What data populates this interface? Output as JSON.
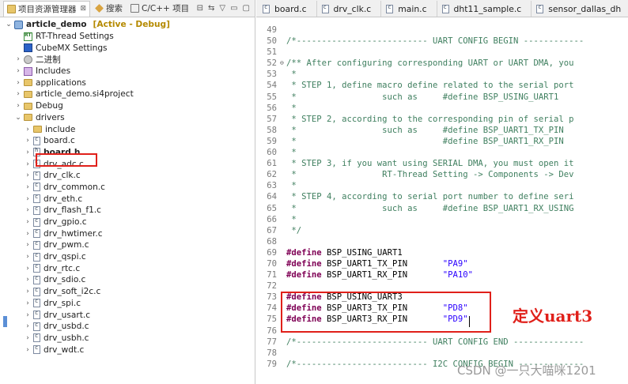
{
  "left_panel": {
    "tabs": [
      {
        "label": "项目资源管理器",
        "active": true,
        "close": "⊠"
      },
      {
        "label": "搜索",
        "active": false
      },
      {
        "label": "C/C++ 项目",
        "active": false
      }
    ],
    "tools": [
      "⊟",
      "⇆",
      "▽",
      "▭",
      "▢"
    ],
    "tree": [
      {
        "depth": 0,
        "twisty": "⌄",
        "icon": "proj",
        "label": "article_demo",
        "status": "[Active - Debug]"
      },
      {
        "depth": 1,
        "twisty": "",
        "icon": "rt",
        "label": "RT-Thread Settings"
      },
      {
        "depth": 1,
        "twisty": "",
        "icon": "mx",
        "label": "CubeMX Settings"
      },
      {
        "depth": 1,
        "twisty": "›",
        "icon": "bin",
        "label": "二进制"
      },
      {
        "depth": 1,
        "twisty": "›",
        "icon": "inc",
        "label": "Includes"
      },
      {
        "depth": 1,
        "twisty": "›",
        "icon": "folder",
        "label": "applications"
      },
      {
        "depth": 1,
        "twisty": "›",
        "icon": "folder",
        "label": "article_demo.si4project"
      },
      {
        "depth": 1,
        "twisty": "›",
        "icon": "folder",
        "label": "Debug"
      },
      {
        "depth": 1,
        "twisty": "⌄",
        "icon": "folder",
        "label": "drivers"
      },
      {
        "depth": 2,
        "twisty": "›",
        "icon": "folder",
        "label": "include"
      },
      {
        "depth": 2,
        "twisty": "›",
        "icon": "file",
        "label": "board.c"
      },
      {
        "depth": 2,
        "twisty": "›",
        "icon": "fileh",
        "label": "board.h",
        "bold": true
      },
      {
        "depth": 2,
        "twisty": "›",
        "icon": "file",
        "label": "drv_adc.c"
      },
      {
        "depth": 2,
        "twisty": "›",
        "icon": "file",
        "label": "drv_clk.c"
      },
      {
        "depth": 2,
        "twisty": "›",
        "icon": "file",
        "label": "drv_common.c"
      },
      {
        "depth": 2,
        "twisty": "›",
        "icon": "file",
        "label": "drv_eth.c"
      },
      {
        "depth": 2,
        "twisty": "›",
        "icon": "file",
        "label": "drv_flash_f1.c"
      },
      {
        "depth": 2,
        "twisty": "›",
        "icon": "file",
        "label": "drv_gpio.c"
      },
      {
        "depth": 2,
        "twisty": "›",
        "icon": "file",
        "label": "drv_hwtimer.c"
      },
      {
        "depth": 2,
        "twisty": "›",
        "icon": "file",
        "label": "drv_pwm.c"
      },
      {
        "depth": 2,
        "twisty": "›",
        "icon": "file",
        "label": "drv_qspi.c"
      },
      {
        "depth": 2,
        "twisty": "›",
        "icon": "file",
        "label": "drv_rtc.c"
      },
      {
        "depth": 2,
        "twisty": "›",
        "icon": "file",
        "label": "drv_sdio.c"
      },
      {
        "depth": 2,
        "twisty": "›",
        "icon": "file",
        "label": "drv_soft_i2c.c"
      },
      {
        "depth": 2,
        "twisty": "›",
        "icon": "file",
        "label": "drv_spi.c"
      },
      {
        "depth": 2,
        "twisty": "›",
        "icon": "file",
        "label": "drv_usart.c"
      },
      {
        "depth": 2,
        "twisty": "›",
        "icon": "file",
        "label": "drv_usbd.c"
      },
      {
        "depth": 2,
        "twisty": "›",
        "icon": "file",
        "label": "drv_usbh.c"
      },
      {
        "depth": 2,
        "twisty": "›",
        "icon": "file",
        "label": "drv_wdt.c"
      }
    ]
  },
  "editor": {
    "tabs": [
      "board.c",
      "drv_clk.c",
      "main.c",
      "dht11_sample.c",
      "sensor_dallas_dh"
    ],
    "lines": [
      {
        "n": "49",
        "parts": [
          {
            "t": "",
            "c": "plain"
          }
        ]
      },
      {
        "n": "50",
        "parts": [
          {
            "t": "/*-------------------------- UART CONFIG BEGIN ------------",
            "c": "cmt"
          }
        ]
      },
      {
        "n": "51",
        "parts": [
          {
            "t": "",
            "c": "plain"
          }
        ]
      },
      {
        "n": "52",
        "fold": "⊖",
        "parts": [
          {
            "t": "/** After configuring corresponding UART or UART DMA, you",
            "c": "cmt"
          }
        ]
      },
      {
        "n": "53",
        "parts": [
          {
            "t": " *",
            "c": "cmt"
          }
        ]
      },
      {
        "n": "54",
        "parts": [
          {
            "t": " * STEP 1, define macro define related to the serial port",
            "c": "cmt"
          }
        ]
      },
      {
        "n": "55",
        "parts": [
          {
            "t": " *                 such as     #define BSP_USING_UART1",
            "c": "cmt"
          }
        ]
      },
      {
        "n": "56",
        "parts": [
          {
            "t": " *",
            "c": "cmt"
          }
        ]
      },
      {
        "n": "57",
        "parts": [
          {
            "t": " * STEP 2, according to the corresponding pin of serial p",
            "c": "cmt"
          }
        ]
      },
      {
        "n": "58",
        "parts": [
          {
            "t": " *                 such as     #define BSP_UART1_TX_PIN",
            "c": "cmt"
          }
        ]
      },
      {
        "n": "59",
        "parts": [
          {
            "t": " *                             #define BSP_UART1_RX_PIN",
            "c": "cmt"
          }
        ]
      },
      {
        "n": "60",
        "parts": [
          {
            "t": " *",
            "c": "cmt"
          }
        ]
      },
      {
        "n": "61",
        "parts": [
          {
            "t": " * STEP 3, if you want using SERIAL DMA, you must open it",
            "c": "cmt"
          }
        ]
      },
      {
        "n": "62",
        "parts": [
          {
            "t": " *                 RT-Thread Setting -> Components -> Dev",
            "c": "cmt"
          }
        ]
      },
      {
        "n": "63",
        "parts": [
          {
            "t": " *",
            "c": "cmt"
          }
        ]
      },
      {
        "n": "64",
        "parts": [
          {
            "t": " * STEP 4, according to serial port number to define seri",
            "c": "cmt"
          }
        ]
      },
      {
        "n": "65",
        "parts": [
          {
            "t": " *                 such as     #define BSP_UART1_RX_USING",
            "c": "cmt"
          }
        ]
      },
      {
        "n": "66",
        "parts": [
          {
            "t": " *",
            "c": "cmt"
          }
        ]
      },
      {
        "n": "67",
        "parts": [
          {
            "t": " */",
            "c": "cmt"
          }
        ]
      },
      {
        "n": "68",
        "parts": [
          {
            "t": "",
            "c": "plain"
          }
        ]
      },
      {
        "n": "69",
        "parts": [
          {
            "t": "#define",
            "c": "kw"
          },
          {
            "t": " BSP_USING_UART1",
            "c": "plain"
          }
        ]
      },
      {
        "n": "70",
        "parts": [
          {
            "t": "#define",
            "c": "kw"
          },
          {
            "t": " BSP_UART1_TX_PIN       ",
            "c": "plain"
          },
          {
            "t": "\"PA9\"",
            "c": "str"
          }
        ]
      },
      {
        "n": "71",
        "parts": [
          {
            "t": "#define",
            "c": "kw"
          },
          {
            "t": " BSP_UART1_RX_PIN       ",
            "c": "plain"
          },
          {
            "t": "\"PA10\"",
            "c": "str"
          }
        ]
      },
      {
        "n": "72",
        "parts": [
          {
            "t": "",
            "c": "plain"
          }
        ]
      },
      {
        "n": "73",
        "parts": [
          {
            "t": "#define",
            "c": "kw"
          },
          {
            "t": " BSP_USING_UART3",
            "c": "plain"
          }
        ]
      },
      {
        "n": "74",
        "parts": [
          {
            "t": "#define",
            "c": "kw"
          },
          {
            "t": " BSP_UART3_TX_PIN       ",
            "c": "plain"
          },
          {
            "t": "\"PD8\"",
            "c": "str"
          }
        ]
      },
      {
        "n": "75",
        "parts": [
          {
            "t": "#define",
            "c": "kw"
          },
          {
            "t": " BSP_UART3_RX_PIN       ",
            "c": "plain"
          },
          {
            "t": "\"PD9\"",
            "c": "str"
          }
        ]
      },
      {
        "n": "76",
        "parts": [
          {
            "t": "",
            "c": "plain"
          }
        ]
      },
      {
        "n": "77",
        "parts": [
          {
            "t": "/*-------------------------- UART CONFIG END --------------",
            "c": "cmt"
          }
        ]
      },
      {
        "n": "78",
        "parts": [
          {
            "t": "",
            "c": "plain"
          }
        ]
      },
      {
        "n": "79",
        "parts": [
          {
            "t": "/*-------------------------- I2C CONFIG BEGIN -------------",
            "c": "cmt"
          }
        ]
      }
    ]
  },
  "annotation": "定义uart3",
  "watermark": "CSDN @一只大喵咪1201",
  "colors": {
    "highlight_box": "#e0201a",
    "comment": "#3f7f5f",
    "keyword": "#7f0055",
    "string": "#2a00ff"
  }
}
